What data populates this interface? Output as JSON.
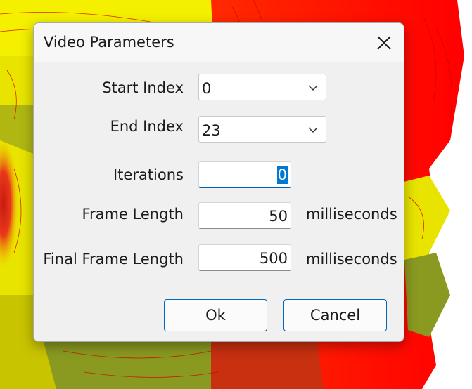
{
  "dialog": {
    "title": "Video Parameters",
    "close_icon": "close-icon"
  },
  "fields": {
    "start_index": {
      "label": "Start Index",
      "value": "0",
      "icon": "chevron-down-icon"
    },
    "end_index": {
      "label": "End Index",
      "value": "23",
      "icon": "chevron-down-icon"
    },
    "iterations": {
      "label": "Iterations",
      "value": "0"
    },
    "frame_length": {
      "label": "Frame Length",
      "value": "50",
      "unit": "milliseconds"
    },
    "final_frame_length": {
      "label": "Final Frame Length",
      "value": "500",
      "unit": "milliseconds"
    }
  },
  "buttons": {
    "ok": "Ok",
    "cancel": "Cancel"
  },
  "colors": {
    "accent": "#0078d4",
    "terrain_yellow": "#ffff00",
    "terrain_red": "#ff1a00",
    "terrain_olive": "#8a9a20"
  }
}
